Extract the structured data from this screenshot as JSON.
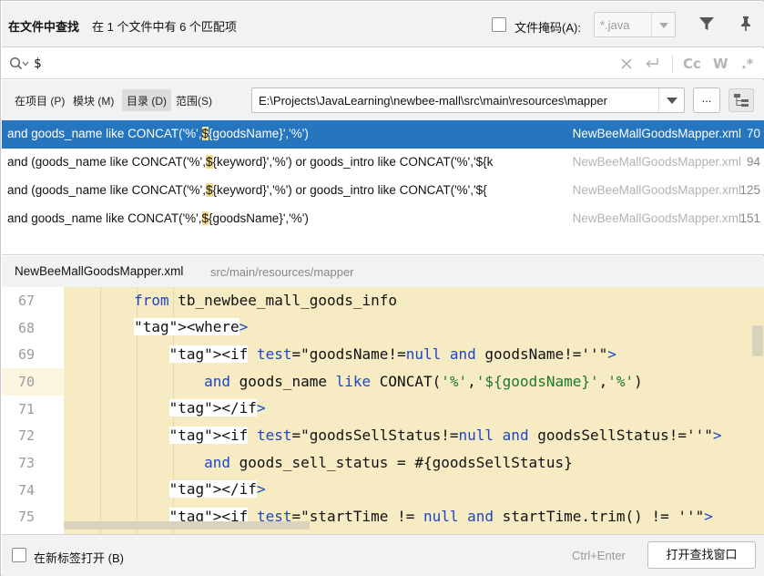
{
  "header": {
    "title": "在文件中查找",
    "match_summary": "在 1 个文件中有 6 个匹配项",
    "file_mask_label": "文件掩码(A):",
    "file_mask_value": "*.java",
    "file_mask_checked": false
  },
  "search": {
    "query": "$",
    "options": [
      "Cc",
      "W",
      ".*"
    ]
  },
  "scope": {
    "tabs": [
      {
        "label": "在项目 (P)",
        "selected": false
      },
      {
        "label": "模块 (M)",
        "selected": false
      },
      {
        "label": "目录 (D)",
        "selected": true
      },
      {
        "label": "范围(S)",
        "selected": false
      }
    ],
    "directory": "E:\\Projects\\JavaLearning\\newbee-mall\\src\\main\\resources\\mapper",
    "browse_label": "..."
  },
  "results": [
    {
      "pre": "and goods_name like CONCAT('%',",
      "match": "$",
      "post": "{goodsName}','%')",
      "file": "NewBeeMallGoodsMapper.xml",
      "line": "70",
      "selected": true
    },
    {
      "pre": "and (goods_name like CONCAT('%',",
      "match": "$",
      "post": "{keyword}','%') or goods_intro like CONCAT('%','${k",
      "file": "NewBeeMallGoodsMapper.xml",
      "line": "94",
      "selected": false
    },
    {
      "pre": "and (goods_name like CONCAT('%',",
      "match": "$",
      "post": "{keyword}','%') or goods_intro like CONCAT('%','${",
      "file": "NewBeeMallGoodsMapper.xml",
      "line": "125",
      "selected": false
    },
    {
      "pre": "and goods_name like CONCAT('%',",
      "match": "$",
      "post": "{goodsName}','%')",
      "file": "NewBeeMallGoodsMapper.xml",
      "line": "151",
      "selected": false
    }
  ],
  "preview": {
    "file": "NewBeeMallGoodsMapper.xml",
    "path": "src/main/resources/mapper",
    "lines": [
      {
        "num": "67",
        "text": "        from tb_newbee_mall_goods_info"
      },
      {
        "num": "68",
        "text": "        <where>"
      },
      {
        "num": "69",
        "text": "            <if test=\"goodsName!=null and goodsName!=''\">"
      },
      {
        "num": "70",
        "text": "                and goods_name like CONCAT('%','${goodsName}','%')"
      },
      {
        "num": "71",
        "text": "            </if>"
      },
      {
        "num": "72",
        "text": "            <if test=\"goodsSellStatus!=null and goodsSellStatus!=''\">"
      },
      {
        "num": "73",
        "text": "                and goods_sell_status = #{goodsSellStatus}"
      },
      {
        "num": "74",
        "text": "            </if>"
      },
      {
        "num": "75",
        "text": "            <if test=\"startTime != null and startTime.trim() != ''\">"
      }
    ],
    "current_line": "70"
  },
  "footer": {
    "new_tab_label": "在新标签打开 (B)",
    "new_tab_checked": false,
    "shortcut": "Ctrl+Enter",
    "open_button": "打开查找窗口"
  }
}
